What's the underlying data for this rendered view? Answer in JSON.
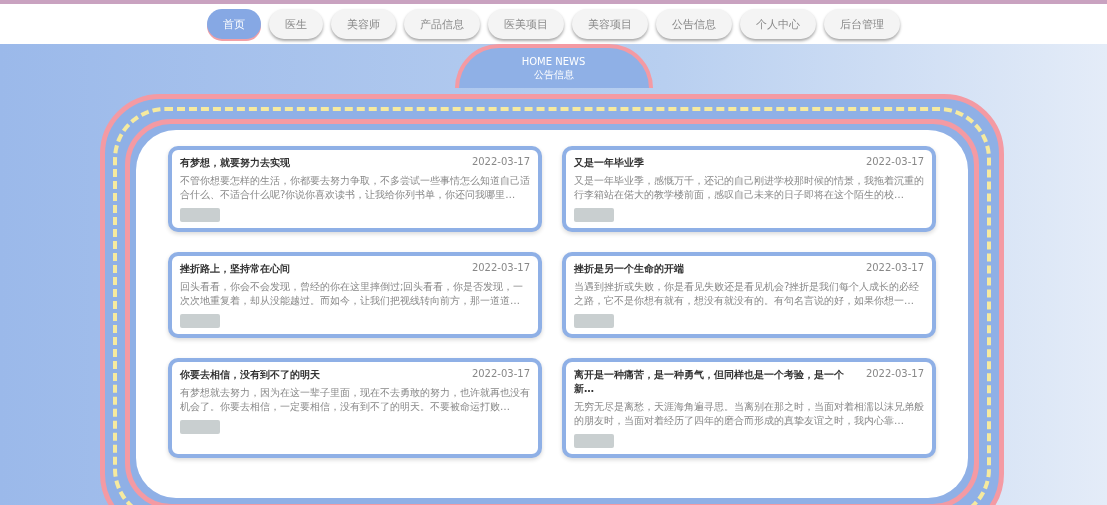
{
  "nav": [
    {
      "label": "首页",
      "selected": true
    },
    {
      "label": "医生",
      "selected": false
    },
    {
      "label": "美容师",
      "selected": false
    },
    {
      "label": "产品信息",
      "selected": false
    },
    {
      "label": "医美项目",
      "selected": false
    },
    {
      "label": "美容项目",
      "selected": false
    },
    {
      "label": "公告信息",
      "selected": false
    },
    {
      "label": "个人中心",
      "selected": false
    },
    {
      "label": "后台管理",
      "selected": false
    }
  ],
  "section": {
    "title": "HOME NEWS",
    "subtitle": "公告信息"
  },
  "news": [
    {
      "title": "有梦想，就要努力去实现",
      "date": "2022-03-17",
      "summary": "不管你想要怎样的生活，你都要去努力争取，不多尝试一些事情怎么知道自己适合什么、不适合什么呢?你说你喜欢读书，让我给你列书单，你还问我哪里…"
    },
    {
      "title": "又是一年毕业季",
      "date": "2022-03-17",
      "summary": "又是一年毕业季，感慨万千，还记的自己刚进学校那时候的情景，我拖着沉重的行李箱站在偌大的教学楼前面，感叹自己未来的日子即将在这个陌生的校…"
    },
    {
      "title": "挫折路上，坚持常在心间",
      "date": "2022-03-17",
      "summary": "回头看看，你会不会发现，曾经的你在这里摔倒过;回头看看，你是否发现，一次次地重复着，却从没能越过。而如今，让我们把视线转向前方，那一道道…"
    },
    {
      "title": "挫折是另一个生命的开端",
      "date": "2022-03-17",
      "summary": "当遇到挫折或失败，你是看见失败还是看见机会?挫折是我们每个人成长的必经之路，它不是你想有就有，想没有就没有的。有句名言说的好，如果你想一…"
    },
    {
      "title": "你要去相信，没有到不了的明天",
      "date": "2022-03-17",
      "summary": "有梦想就去努力，因为在这一辈子里面，现在不去勇敢的努力，也许就再也没有机会了。你要去相信，一定要相信，没有到不了的明天。不要被命运打败…"
    },
    {
      "title": "离开是一种痛苦，是一种勇气，但同样也是一个考验，是一个新…",
      "date": "2022-03-17",
      "summary": "无穷无尽是离愁，天涯海角遍寻思。当离别在那之时，当面对着相濡以沫兄弟般的朋友时，当面对着经历了四年的磨合而形成的真挚友谊之时，我内心靠…"
    }
  ]
}
